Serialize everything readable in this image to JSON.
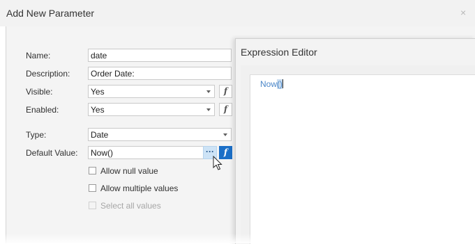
{
  "dialog": {
    "title": "Add New Parameter",
    "close_glyph": "×"
  },
  "form": {
    "name_label": "Name:",
    "name_value": "date",
    "description_label": "Description:",
    "description_value": "Order Date:",
    "visible_label": "Visible:",
    "visible_value": "Yes",
    "enabled_label": "Enabled:",
    "enabled_value": "Yes",
    "type_label": "Type:",
    "type_value": "Date",
    "default_label": "Default Value:",
    "default_value": "Now()",
    "ellipsis_glyph": "···",
    "fx_glyph": "f",
    "checkboxes": [
      {
        "label": "Allow null value",
        "checked": false,
        "enabled": true
      },
      {
        "label": "Allow multiple values",
        "checked": false,
        "enabled": true
      },
      {
        "label": "Select all values",
        "checked": false,
        "enabled": false
      }
    ]
  },
  "expression_editor": {
    "title": "Expression Editor",
    "code_function": "Now",
    "code_parens": "()"
  },
  "icons": [
    "close-icon",
    "fx-icon",
    "ellipsis-icon",
    "dropdown-arrow-icon",
    "mouse-cursor-icon"
  ],
  "colors": {
    "accent": "#1b6fc7",
    "expression_text": "#4a86c8",
    "selection": "#c9dcef"
  }
}
